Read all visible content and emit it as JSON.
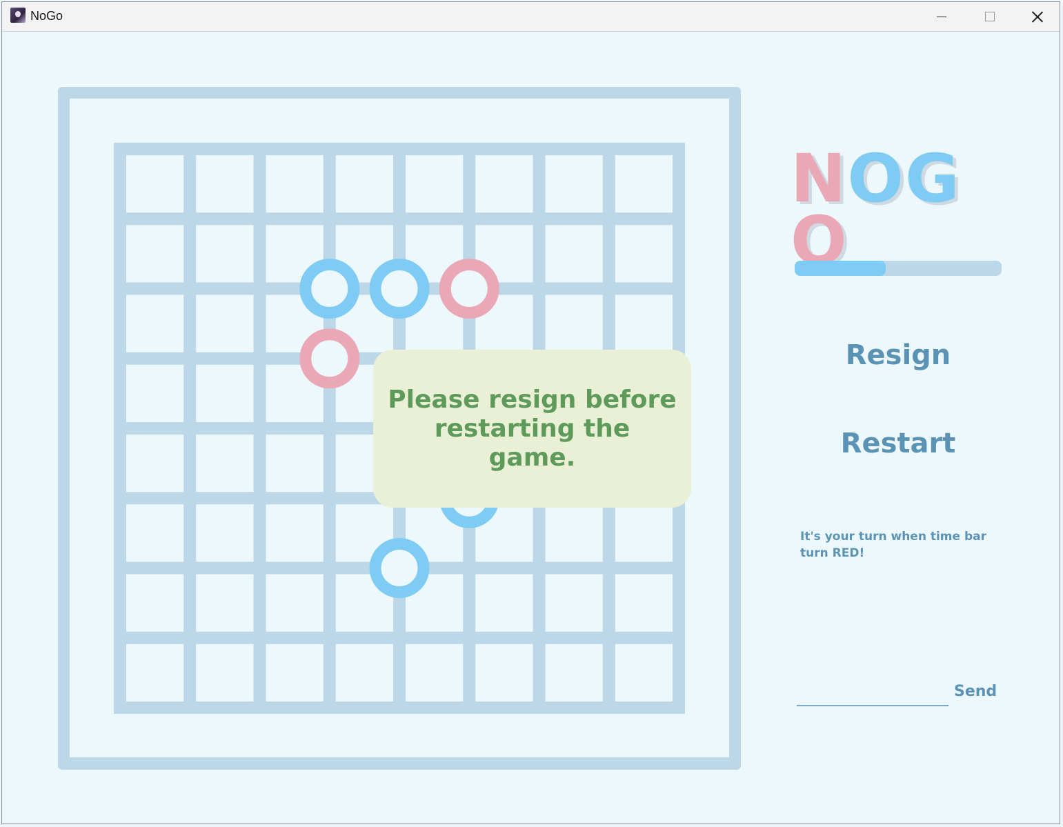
{
  "window": {
    "title": "NoGo",
    "icon": "app-avatar-icon",
    "controls": [
      "minimize-icon",
      "maximize-icon",
      "close-icon"
    ]
  },
  "colors": {
    "background": "#edf8fd",
    "board_lines": "#bcd7e8",
    "blue_stone": "#7ecbf4",
    "pink_stone": "#eaa8b6",
    "accent_text": "#5b93b5",
    "message_bg": "#e9f0d5",
    "message_text": "#5e9a5a"
  },
  "board": {
    "size": 9,
    "stones": [
      {
        "col": 3,
        "row": 2,
        "color": "blue"
      },
      {
        "col": 4,
        "row": 2,
        "color": "blue"
      },
      {
        "col": 5,
        "row": 2,
        "color": "pink"
      },
      {
        "col": 3,
        "row": 3,
        "color": "pink"
      },
      {
        "col": 5,
        "row": 5,
        "color": "blue"
      },
      {
        "col": 4,
        "row": 6,
        "color": "blue"
      }
    ]
  },
  "message": {
    "text": "Please resign before restarting the game."
  },
  "panel": {
    "logo_text": "NOGO",
    "time_bar_fraction": 0.44,
    "resign_label": "Resign",
    "restart_label": "Restart",
    "hint_text": "It's your turn when time bar turn RED!",
    "chat_value": "",
    "send_label": "Send"
  }
}
